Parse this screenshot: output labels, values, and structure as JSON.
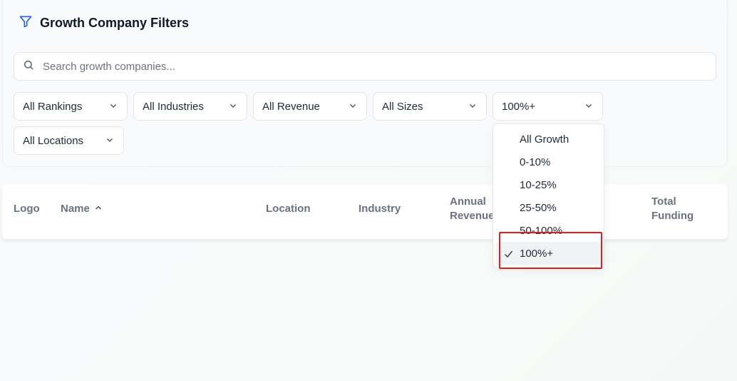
{
  "filters": {
    "title": "Growth Company Filters",
    "title_icon": "filter-icon",
    "search_placeholder": "Search growth companies...",
    "selects": {
      "rankings": "All Rankings",
      "industries": "All Industries",
      "revenue": "All Revenue",
      "sizes": "All Sizes",
      "growth": "100%+",
      "locations": "All Locations"
    }
  },
  "table": {
    "headers": {
      "logo": "Logo",
      "name": "Name",
      "location": "Location",
      "industry": "Industry",
      "annual_revenue_1": "Annual",
      "annual_revenue_2": "Revenue",
      "total_funding_1": "Total",
      "total_funding_2": "Funding"
    },
    "sort": {
      "column": "Name",
      "direction": "ascending"
    }
  },
  "growth_dropdown": {
    "options": [
      "All Growth",
      "0-10%",
      "10-25%",
      "25-50%",
      "50-100%",
      "100%+"
    ],
    "selected": "100%+"
  },
  "colors": {
    "accent": "#2563eb",
    "highlight_box": "#e31b1b",
    "selected_option_bg": "#f1f2f4"
  }
}
